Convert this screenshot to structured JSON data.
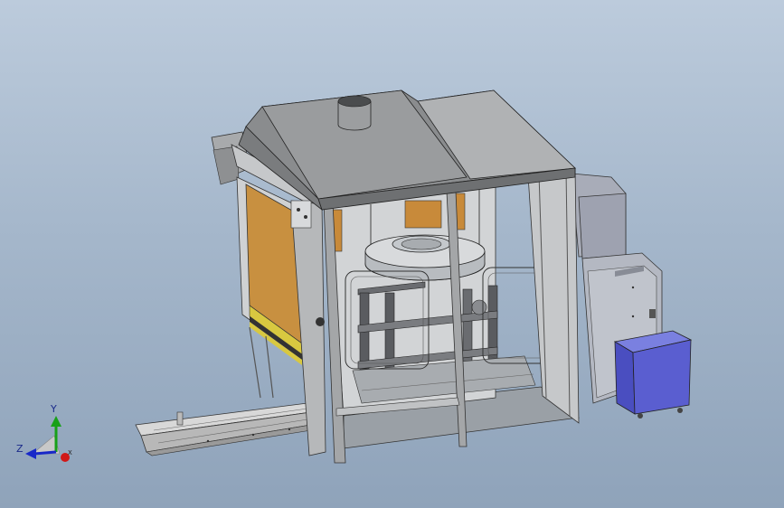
{
  "viewport": {
    "background_top": "#bccbdc",
    "background_bottom": "#8fa3ba"
  },
  "triad": {
    "x_label": "X",
    "y_label": "Y",
    "z_label": "Z",
    "x_color": "#d01818",
    "y_color": "#18a018",
    "z_color": "#1828c8"
  },
  "model": {
    "frame_color": "#9aa0a4",
    "panel_color": "#c8c8c8",
    "hood_color": "#8a8c8e",
    "shutter_color": "#c89040",
    "controller_color": "#5a5ed0"
  }
}
